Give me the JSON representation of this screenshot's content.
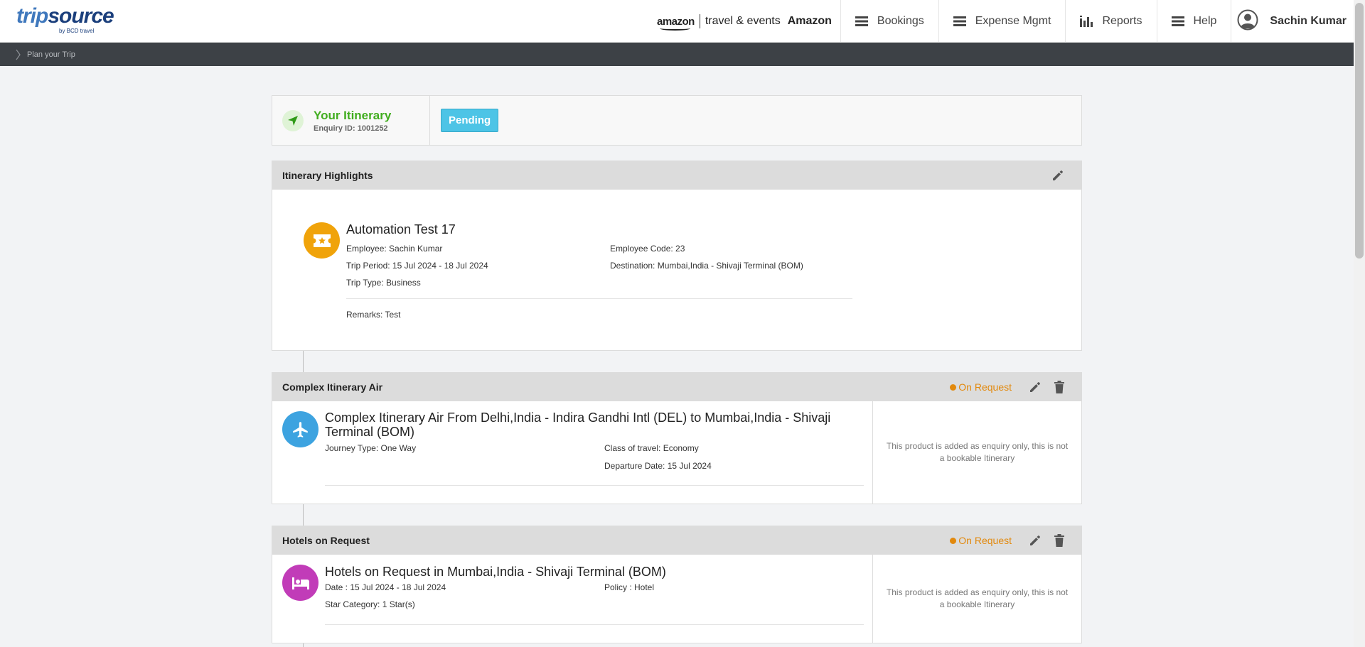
{
  "header": {
    "logo_main_1": "trip",
    "logo_main_2": "source",
    "logo_sub": "by BCD travel",
    "brand_logo": "amazon",
    "brand_te": "travel & events",
    "company": "Amazon",
    "nav": [
      {
        "label": "Bookings",
        "icon": "menu-icon"
      },
      {
        "label": "Expense Mgmt",
        "icon": "menu-icon"
      },
      {
        "label": "Reports",
        "icon": "bar-chart-icon"
      },
      {
        "label": "Help",
        "icon": "menu-icon"
      }
    ],
    "user_name": "Sachin Kumar"
  },
  "breadcrumb": {
    "item": "Plan your Trip"
  },
  "itinerary": {
    "title": "Your Itinerary",
    "enquiry": "Enquiry ID: 1001252",
    "status_badge": "Pending"
  },
  "highlights": {
    "heading": "Itinerary Highlights",
    "title": "Automation Test 17",
    "employee": "Employee: Sachin Kumar",
    "employee_code": "Employee Code: 23",
    "trip_period": "Trip Period: 15 Jul 2024 - 18 Jul 2024",
    "destination": "Destination: Mumbai,India - Shivaji Terminal (BOM)",
    "trip_type": "Trip Type: Business",
    "remarks": "Remarks: Test"
  },
  "air": {
    "heading": "Complex Itinerary Air",
    "status": "On Request",
    "title": "Complex Itinerary Air From Delhi,India - Indira Gandhi Intl (DEL) to Mumbai,India - Shivaji Terminal (BOM)",
    "journey_type": "Journey Type: One Way",
    "class": "Class of travel: Economy",
    "departure": "Departure Date: 15 Jul 2024",
    "note": "This product is added as enquiry only, this is not a bookable Itinerary"
  },
  "hotel": {
    "heading": "Hotels on Request",
    "status": "On Request",
    "title": "Hotels on Request in Mumbai,India - Shivaji Terminal (BOM)",
    "date": "Date : 15 Jul 2024 - 18 Jul 2024",
    "policy": "Policy : Hotel",
    "star": "Star Category: 1 Star(s)",
    "note": "This product is added as enquiry only, this is not a bookable Itinerary"
  },
  "colors": {
    "accent_green": "#41ad1f",
    "pending": "#4dc4e6",
    "on_request": "#e2890d",
    "air_icon": "#3da3e0",
    "hotel_icon": "#c13cb8",
    "ticket_icon": "#f0a30a"
  }
}
